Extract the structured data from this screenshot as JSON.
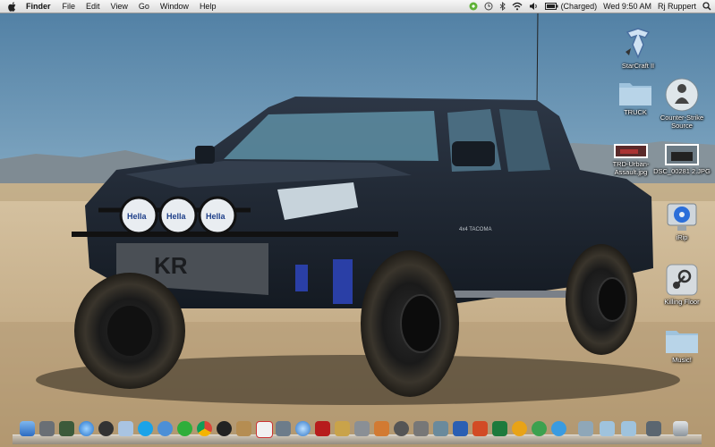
{
  "menubar": {
    "app_name": "Finder",
    "menus": [
      "File",
      "Edit",
      "View",
      "Go",
      "Window",
      "Help"
    ],
    "battery_status": "(Charged)",
    "clock": "Wed 9:50 AM",
    "user_name": "Rj Ruppert"
  },
  "wallpaper": {
    "grille_logo": "KR",
    "light_brand": "Hella",
    "door_badge": "4x4 TACOMA"
  },
  "desktop_icons": [
    {
      "label": "StarCraft II",
      "icon": "starcraft-icon"
    },
    {
      "label": "TRUCK",
      "icon": "folder-icon"
    },
    {
      "label": "Counter-Strike Source",
      "icon": "counter-strike-icon"
    },
    {
      "label": "TRD-Urban-Assault.jpg",
      "icon": "image-file-icon"
    },
    {
      "label": "DSC_00281 2.JPG",
      "icon": "image-file-icon"
    },
    {
      "label": "iRip",
      "icon": "irip-icon"
    },
    {
      "label": "Killing Floor",
      "icon": "steam-icon"
    },
    {
      "label": "Music!",
      "icon": "folder-icon"
    }
  ],
  "dock": {
    "items": [
      "finder",
      "rocket",
      "notes",
      "safari",
      "dashboard",
      "preview",
      "skype",
      "network",
      "spotify",
      "chrome",
      "steam",
      "contacts",
      "ical",
      "itunes",
      "photo",
      "pdf",
      "flickr",
      "zip",
      "instruments",
      "itunes-store",
      "system-preferences",
      "terminal",
      "word",
      "powerpoint",
      "excel",
      "outlook",
      "messenger",
      "sims",
      "syncmate",
      "downloads",
      "folder",
      "folder",
      "trash"
    ]
  },
  "colors": {
    "menubar": "#e6e6e6",
    "sky": "#7fa5c0",
    "truck": "#1c2430"
  }
}
